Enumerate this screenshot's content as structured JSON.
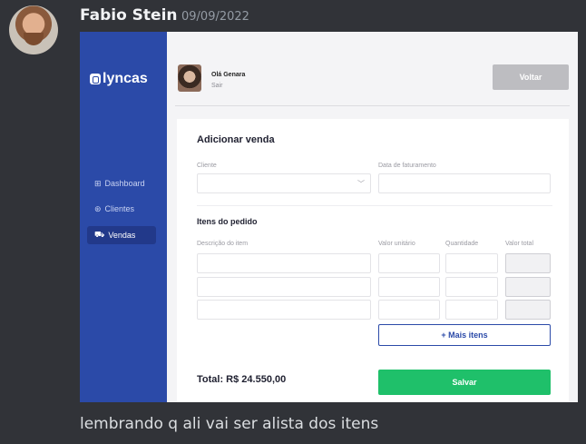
{
  "chat": {
    "author": "Fabio Stein",
    "timestamp": "09/09/2022",
    "message": "lembrando q ali vai ser alista dos itens"
  },
  "app": {
    "logo": "lyncas",
    "nav": [
      {
        "icon": "grid-icon",
        "label": "Dashboard"
      },
      {
        "icon": "users-icon",
        "label": "Clientes"
      },
      {
        "icon": "cart-icon",
        "label": "Vendas"
      }
    ],
    "user": {
      "greeting": "Olá Genara",
      "logout": "Sair"
    },
    "back_button": "Voltar",
    "form": {
      "title": "Adicionar venda",
      "client_label": "Cliente",
      "client_value": "",
      "billing_date_label": "Data de faturamento",
      "billing_date_value": "",
      "items_title": "Itens do pedido",
      "columns": [
        "Descrição do item",
        "Valor unitário",
        "Quantidade",
        "Valor total"
      ],
      "rows": [
        {
          "description": "",
          "unit_price": "",
          "quantity": "",
          "total": ""
        },
        {
          "description": "",
          "unit_price": "",
          "quantity": "",
          "total": ""
        },
        {
          "description": "",
          "unit_price": "",
          "quantity": "",
          "total": ""
        }
      ],
      "add_items_button": "+ Mais itens",
      "total_text": "Total: R$ 24.550,00",
      "save_button": "Salvar"
    }
  }
}
